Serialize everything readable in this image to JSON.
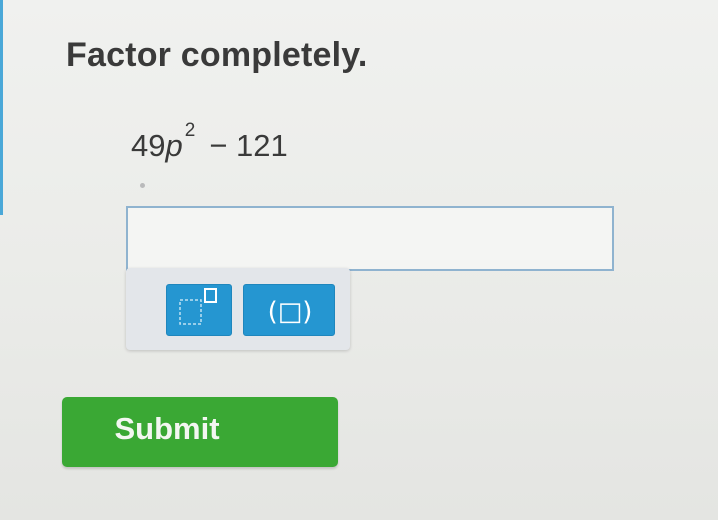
{
  "question": {
    "instruction": "Factor completely.",
    "expression": {
      "coefficient": "49",
      "variable": "p",
      "exponent": "2",
      "rest": "− 121"
    }
  },
  "answer": {
    "value": ""
  },
  "palette": {
    "buttons": [
      {
        "id": "exponent",
        "icon": "exponent-template-icon"
      },
      {
        "id": "parentheses",
        "label": "(□)",
        "icon": "parentheses-template-icon"
      }
    ]
  },
  "submit": {
    "label": "Submit"
  },
  "colors": {
    "accent_blue": "#2596d1",
    "submit_green": "#3aa834",
    "input_border": "#8fb3cf"
  }
}
